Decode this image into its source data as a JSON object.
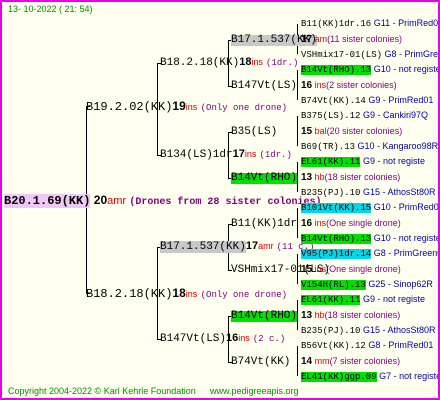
{
  "timestamp": "13- 10-2022 ( 21: 54)",
  "footer": {
    "copyright": "Copyright 2004-2022 © Karl Kehrle Foundation",
    "site": "www.pedigreeapis.org"
  },
  "root": {
    "name": "B20.1.69(KK)",
    "num": "20",
    "tag": "amr",
    "note": "(Drones from 28 sister colonies)"
  },
  "g1": [
    {
      "name": "B19.2.02(KK)",
      "num": "19",
      "tag": "ins",
      "note": "(Only one drone)"
    },
    {
      "name": "B18.2.18(KK)",
      "num": "18",
      "tag": "ins",
      "note": "(Only one drone)"
    }
  ],
  "g2": [
    {
      "name": "B18.2.18(KK)",
      "num": "18",
      "tag": "ins",
      "note": "(1dr.)"
    },
    {
      "name": "B134(LS)1dr",
      "num": "17",
      "tag": "ins",
      "note": "(1dr.)"
    },
    {
      "name": "B17.1.537(KK)",
      "num": "17",
      "tag": "amr",
      "note": "(11 c.)"
    },
    {
      "name": "B147Vt(LS)",
      "num": "16",
      "tag": "ins",
      "note": "(2 c.)"
    }
  ],
  "g3": [
    {
      "name": "B17.1.537(KK)",
      "num": "17",
      "tag": "am",
      "note": "(11 sister colonies)"
    },
    {
      "name": "B147Vt(LS)",
      "num": "16",
      "tag": "ins",
      "note": "(2 sister colonies)"
    },
    {
      "name": "B35(LS)",
      "num": "15",
      "tag": "bal",
      "note": "(20 sister colonies)"
    },
    {
      "name": "B14Vt(RHO)",
      "num": "13",
      "tag": "hb",
      "note": "(18 sister colonies)"
    },
    {
      "name": "B11(KK)1dr",
      "num": "16",
      "tag": "ins",
      "note": "(One single drone)"
    },
    {
      "name": "VSHmix17-01(LS)",
      "num": "15",
      "tag": "ins",
      "note": "(One single drone)"
    },
    {
      "name": "B14Vt(RHO)",
      "num": "13",
      "tag": "hb",
      "note": "(18 sister colonies)"
    },
    {
      "name": "B74Vt(KK)",
      "num": "14",
      "tag": "mm",
      "note": "(7 sister colonies)"
    }
  ],
  "g4": [
    {
      "name": "B11(KK)1dr.16",
      "code": "G11 - PrimRed01"
    },
    {
      "name": "VSHmix17-01(LS)",
      "code": "G8 - PrimGreen00"
    },
    {
      "name": "B14Vt(RHO).13",
      "code": "G10 - not registe"
    },
    {
      "name": "B74Vt(KK).14",
      "code": "G9 - PrimRed01"
    },
    {
      "name": "B375(LS).12",
      "code": "G9 - Cankiri97Q"
    },
    {
      "name": "B69(TR).13",
      "code": "G10 - Kangaroo98R"
    },
    {
      "name": "EL61(KK).11",
      "code": "G9 - not registe"
    },
    {
      "name": "B235(PJ).10",
      "code": "G15 - AthosSt80R"
    },
    {
      "name": "B101Vt(KK).15",
      "code": "G10 - PrimRed01"
    },
    {
      "name": "B14Vt(RHO).13",
      "code": "G10 - not registe"
    },
    {
      "name": "V95(PJ)1dr.14",
      "code": "G8 - PrimGreen00"
    },
    {
      "name": "V154H(RL).13",
      "code": "G25 - Sinop62R"
    },
    {
      "name": "EL61(KK).11",
      "code": "G9 - not registe"
    },
    {
      "name": "B235(PJ).10",
      "code": "G15 - AthosSt80R"
    },
    {
      "name": "B56Vt(KK).12",
      "code": "G8 - PrimRed01"
    },
    {
      "name": "EL41(KK)ggp.09",
      "code": "G7 - not registe"
    }
  ]
}
